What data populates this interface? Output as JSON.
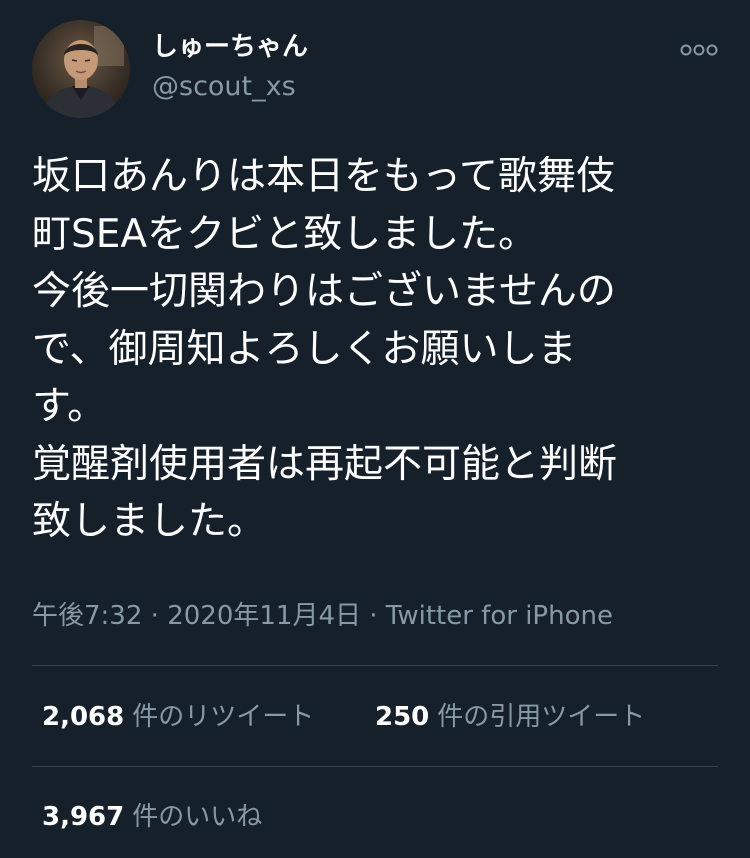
{
  "user": {
    "display_name": "しゅーちゃん",
    "handle": "@scout_xs"
  },
  "tweet": {
    "lines": [
      "坂口あんりは本日をもって歌舞伎",
      "町SEAをクビと致しました。",
      "今後一切関わりはございませんの",
      "で、御周知よろしくお願いしま",
      "す。",
      "覚醒剤使用者は再起不可能と判断",
      "致しました。"
    ],
    "time": "午後7:32",
    "date": "2020年11月4日",
    "separator": "·",
    "source": "Twitter for iPhone"
  },
  "stats": {
    "retweets": {
      "count": "2,068",
      "label": "件のリツイート"
    },
    "quotes": {
      "count": "250",
      "label": "件の引用ツイート"
    },
    "likes": {
      "count": "3,967",
      "label": "件のいいね"
    }
  },
  "icons": {
    "more": "more-horizontal-icon",
    "avatar": "user-avatar-photo"
  },
  "colors": {
    "background": "#15202b",
    "primary_text": "#ffffff",
    "secondary_text": "#8899a6",
    "divider": "#38444d"
  }
}
